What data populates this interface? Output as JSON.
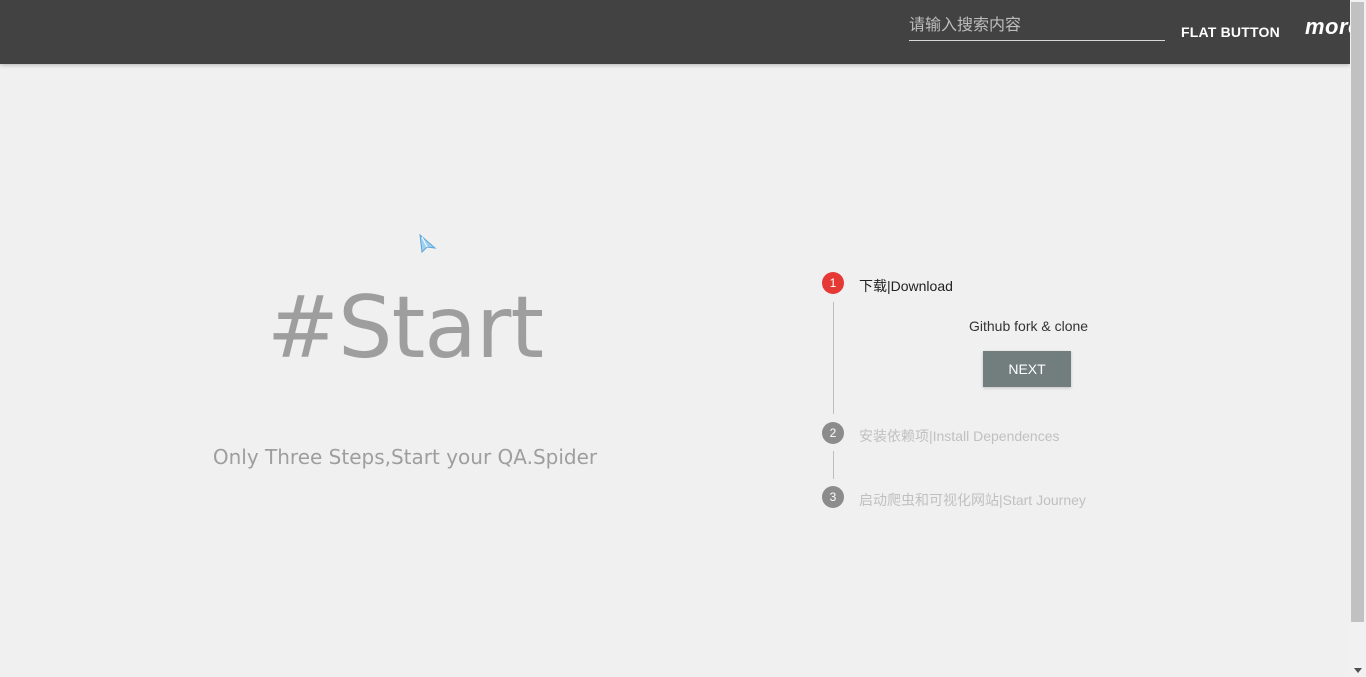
{
  "toolbar": {
    "search_placeholder": "请输入搜索内容",
    "flat_button_label": "FLAT BUTTON",
    "more_label": "more"
  },
  "hero": {
    "title": "#Start",
    "subtitle": "Only Three Steps,Start your QA.Spider"
  },
  "stepper": {
    "steps": [
      {
        "number": "1",
        "label": "下载|Download",
        "state": "active"
      },
      {
        "number": "2",
        "label": "安装依赖项|Install Dependences",
        "state": "pending"
      },
      {
        "number": "3",
        "label": "启动爬虫和可视化网站|Start Journey",
        "state": "pending"
      }
    ],
    "active_content": {
      "description": "Github fork & clone",
      "next_label": "NEXT"
    }
  },
  "colors": {
    "appbar": "#424242",
    "active_step": "#e53935",
    "pending_step": "#8c8c8c",
    "next_button": "#727d7d"
  }
}
